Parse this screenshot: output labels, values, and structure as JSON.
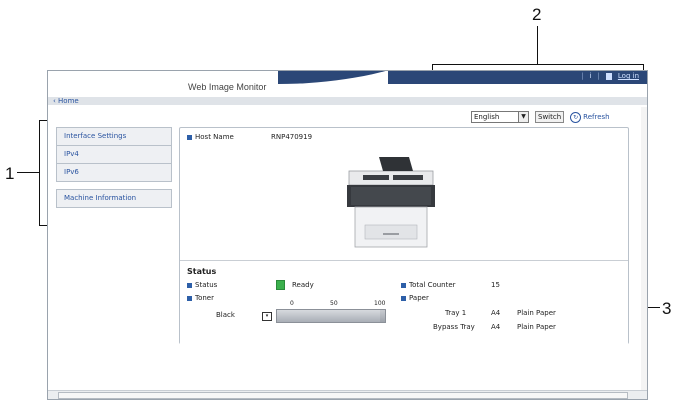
{
  "callouts": {
    "c1": "1",
    "c2": "2",
    "c3": "3"
  },
  "header": {
    "title": "Web Image Monitor",
    "info_label": "i",
    "login_label": "Log in"
  },
  "nav": {
    "home": "Home"
  },
  "toolbar": {
    "language": "English",
    "switch_label": "Switch",
    "refresh_label": "Refresh"
  },
  "sidebar": {
    "items": [
      {
        "label": "Interface Settings"
      },
      {
        "label": "IPv4"
      },
      {
        "label": "IPv6"
      },
      {
        "label": "Machine Information"
      }
    ]
  },
  "host": {
    "label": "Host Name",
    "value": "RNP470919"
  },
  "status": {
    "title": "Status",
    "status_label": "Status",
    "status_value": "Ready",
    "toner_label": "Toner",
    "toner_color": "Black",
    "toner_level_fraction": 0.95,
    "scale": [
      "0",
      "50",
      "100"
    ],
    "counter_label": "Total Counter",
    "counter_value": "15",
    "paper_label": "Paper",
    "trays": [
      {
        "name": "Tray 1",
        "size": "A4",
        "type": "Plain Paper"
      },
      {
        "name": "Bypass Tray",
        "size": "A4",
        "type": "Plain Paper"
      }
    ]
  },
  "colors": {
    "accent": "#2d5fa8",
    "band": "#2b4777",
    "ready": "#3bb04d"
  }
}
